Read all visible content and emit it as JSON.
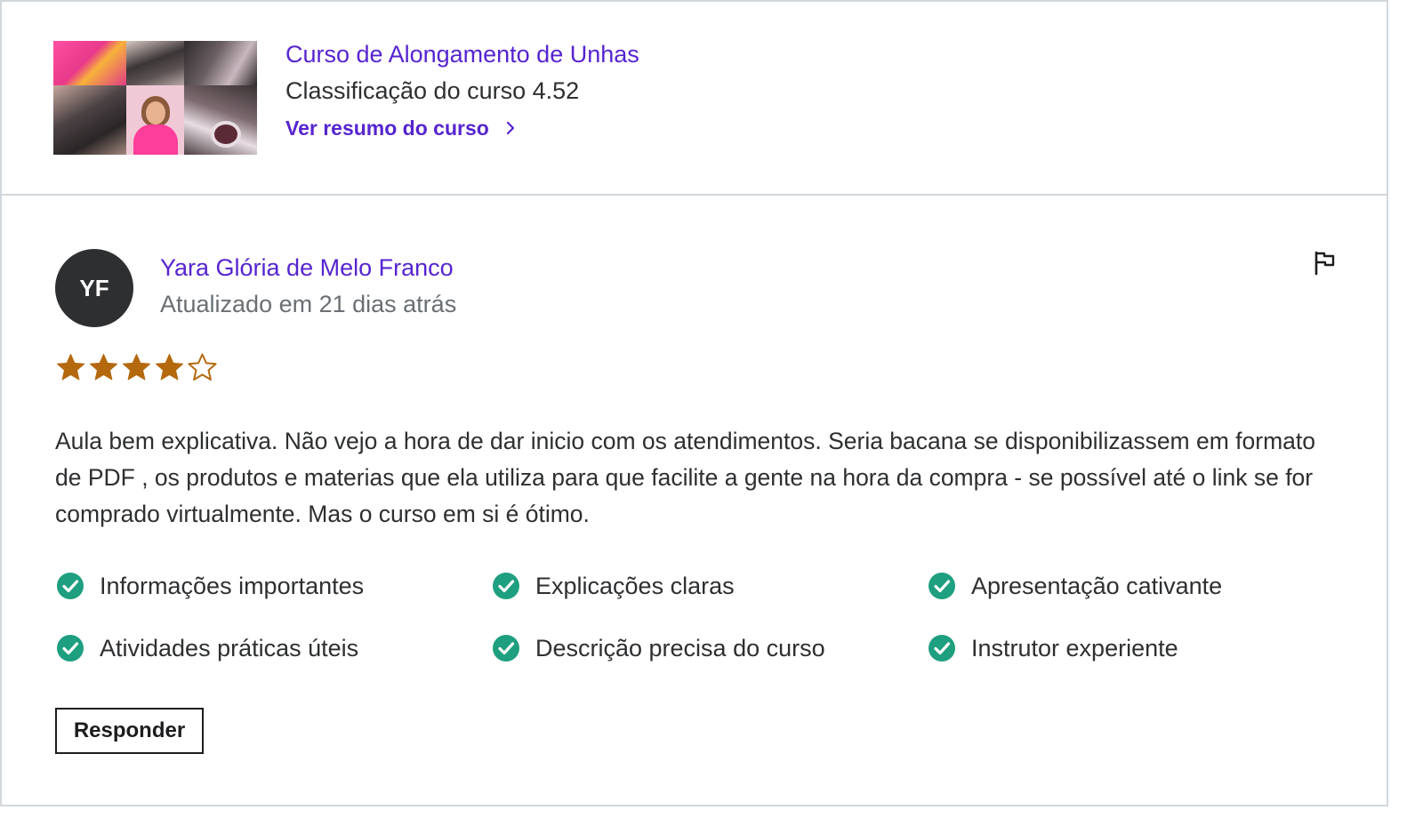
{
  "course": {
    "title": "Curso de Alongamento de Unhas",
    "rating_text": "Classificação do curso 4.52",
    "summary_link": "Ver resumo do curso"
  },
  "review": {
    "avatar_initials": "YF",
    "reviewer_name": "Yara Glória de Melo Franco",
    "updated_text": "Atualizado em 21 dias atrás",
    "rating": 4,
    "max_rating": 5,
    "text": "Aula bem explicativa. Não vejo a hora de dar inicio com os atendimentos. Seria bacana se disponibilizassem em formato de PDF , os produtos e materias que ela utiliza para que facilite a gente na hora da compra - se possível até o link se for comprado virtualmente. Mas o curso em si é ótimo.",
    "features": [
      "Informações importantes",
      "Explicações claras",
      "Apresentação cativante",
      "Atividades práticas úteis",
      "Descrição precisa do curso",
      "Instrutor experiente"
    ],
    "reply_label": "Responder"
  },
  "icons": {
    "flag": "flag-icon",
    "chevron": "chevron-right-icon",
    "star_filled": "star-filled-icon",
    "star_empty": "star-outline-icon",
    "check": "check-circle-icon"
  },
  "colors": {
    "accent": "#5624d0",
    "star": "#b4690e",
    "check": "#1e9f7f",
    "avatar_bg": "#2d2f31",
    "border": "#d1d7dc"
  }
}
